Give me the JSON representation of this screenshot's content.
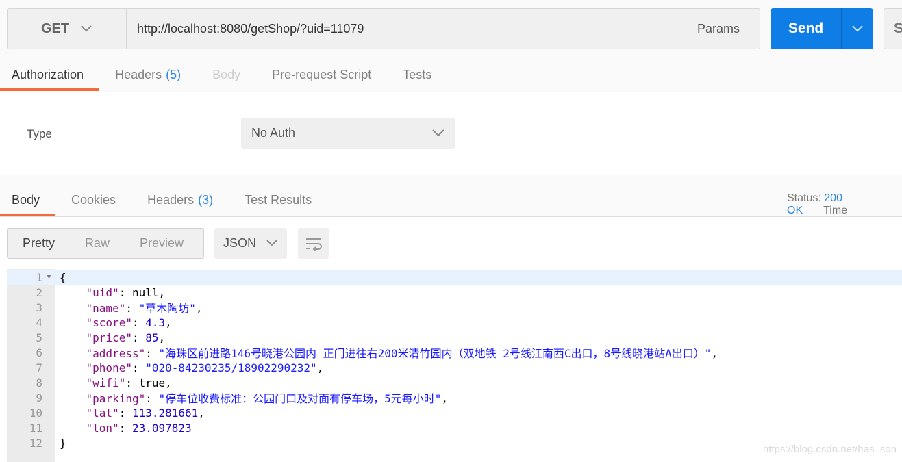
{
  "request": {
    "method": "GET",
    "url": "http://localhost:8080/getShop/?uid=11079",
    "params_label": "Params",
    "send_label": "Send",
    "save_label": "Sa"
  },
  "request_tabs": [
    {
      "label": "Authorization",
      "count": "",
      "state": "active"
    },
    {
      "label": "Headers",
      "count": "(5)",
      "state": ""
    },
    {
      "label": "Body",
      "count": "",
      "state": "dis"
    },
    {
      "label": "Pre-request Script",
      "count": "",
      "state": ""
    },
    {
      "label": "Tests",
      "count": "",
      "state": ""
    }
  ],
  "auth": {
    "type_label": "Type",
    "type_value": "No Auth"
  },
  "response_tabs": [
    {
      "label": "Body",
      "count": "",
      "state": "active"
    },
    {
      "label": "Cookies",
      "count": "",
      "state": ""
    },
    {
      "label": "Headers",
      "count": "(3)",
      "state": ""
    },
    {
      "label": "Test Results",
      "count": "",
      "state": ""
    }
  ],
  "status": {
    "label": "Status:",
    "value": "200 OK",
    "time_label": "Time"
  },
  "view_modes": [
    {
      "label": "Pretty",
      "active": true
    },
    {
      "label": "Raw",
      "active": false
    },
    {
      "label": "Preview",
      "active": false
    }
  ],
  "format": "JSON",
  "icons": {
    "wrap": "wrap-lines-icon",
    "chevron": "chevron-down-icon",
    "fold": "fold-triangle-icon"
  },
  "colors": {
    "accent": "#0e7ee6",
    "tab_underline": "#f26b3a",
    "status": "#2a86e0"
  },
  "code_lines": [
    {
      "n": "1",
      "t": [
        [
          "p",
          "{"
        ]
      ]
    },
    {
      "n": "2",
      "t": [
        [
          "p",
          "    "
        ],
        [
          "k",
          "\"uid\""
        ],
        [
          "p",
          ": null,"
        ]
      ]
    },
    {
      "n": "3",
      "t": [
        [
          "p",
          "    "
        ],
        [
          "k",
          "\"name\""
        ],
        [
          "p",
          ": "
        ],
        [
          "s",
          "\"草木陶坊\""
        ],
        [
          "p",
          ","
        ]
      ]
    },
    {
      "n": "4",
      "t": [
        [
          "p",
          "    "
        ],
        [
          "k",
          "\"score\""
        ],
        [
          "p",
          ": "
        ],
        [
          "n",
          "4.3"
        ],
        [
          "p",
          ","
        ]
      ]
    },
    {
      "n": "5",
      "t": [
        [
          "p",
          "    "
        ],
        [
          "k",
          "\"price\""
        ],
        [
          "p",
          ": "
        ],
        [
          "n",
          "85"
        ],
        [
          "p",
          ","
        ]
      ]
    },
    {
      "n": "6",
      "t": [
        [
          "p",
          "    "
        ],
        [
          "k",
          "\"address\""
        ],
        [
          "p",
          ": "
        ],
        [
          "s",
          "\"海珠区前进路146号晓港公园内 正门进往右200米清竹园内（双地铁 2号线江南西C出口，8号线晓港站A出口）\""
        ],
        [
          "p",
          ","
        ]
      ]
    },
    {
      "n": "7",
      "t": [
        [
          "p",
          "    "
        ],
        [
          "k",
          "\"phone\""
        ],
        [
          "p",
          ": "
        ],
        [
          "s",
          "\"020-84230235/18902290232\""
        ],
        [
          "p",
          ","
        ]
      ]
    },
    {
      "n": "8",
      "t": [
        [
          "p",
          "    "
        ],
        [
          "k",
          "\"wifi\""
        ],
        [
          "p",
          ": true,"
        ]
      ]
    },
    {
      "n": "9",
      "t": [
        [
          "p",
          "    "
        ],
        [
          "k",
          "\"parking\""
        ],
        [
          "p",
          ": "
        ],
        [
          "s",
          "\"停车位收费标准：公园门口及对面有停车场，5元每小时\""
        ],
        [
          "p",
          ","
        ]
      ]
    },
    {
      "n": "10",
      "t": [
        [
          "p",
          "    "
        ],
        [
          "k",
          "\"lat\""
        ],
        [
          "p",
          ": "
        ],
        [
          "n",
          "113.281661"
        ],
        [
          "p",
          ","
        ]
      ]
    },
    {
      "n": "11",
      "t": [
        [
          "p",
          "    "
        ],
        [
          "k",
          "\"lon\""
        ],
        [
          "p",
          ": "
        ],
        [
          "n",
          "23.097823"
        ]
      ]
    },
    {
      "n": "12",
      "t": [
        [
          "p",
          "}"
        ]
      ]
    }
  ],
  "watermark": "https://blog.csdn.net/has_son"
}
